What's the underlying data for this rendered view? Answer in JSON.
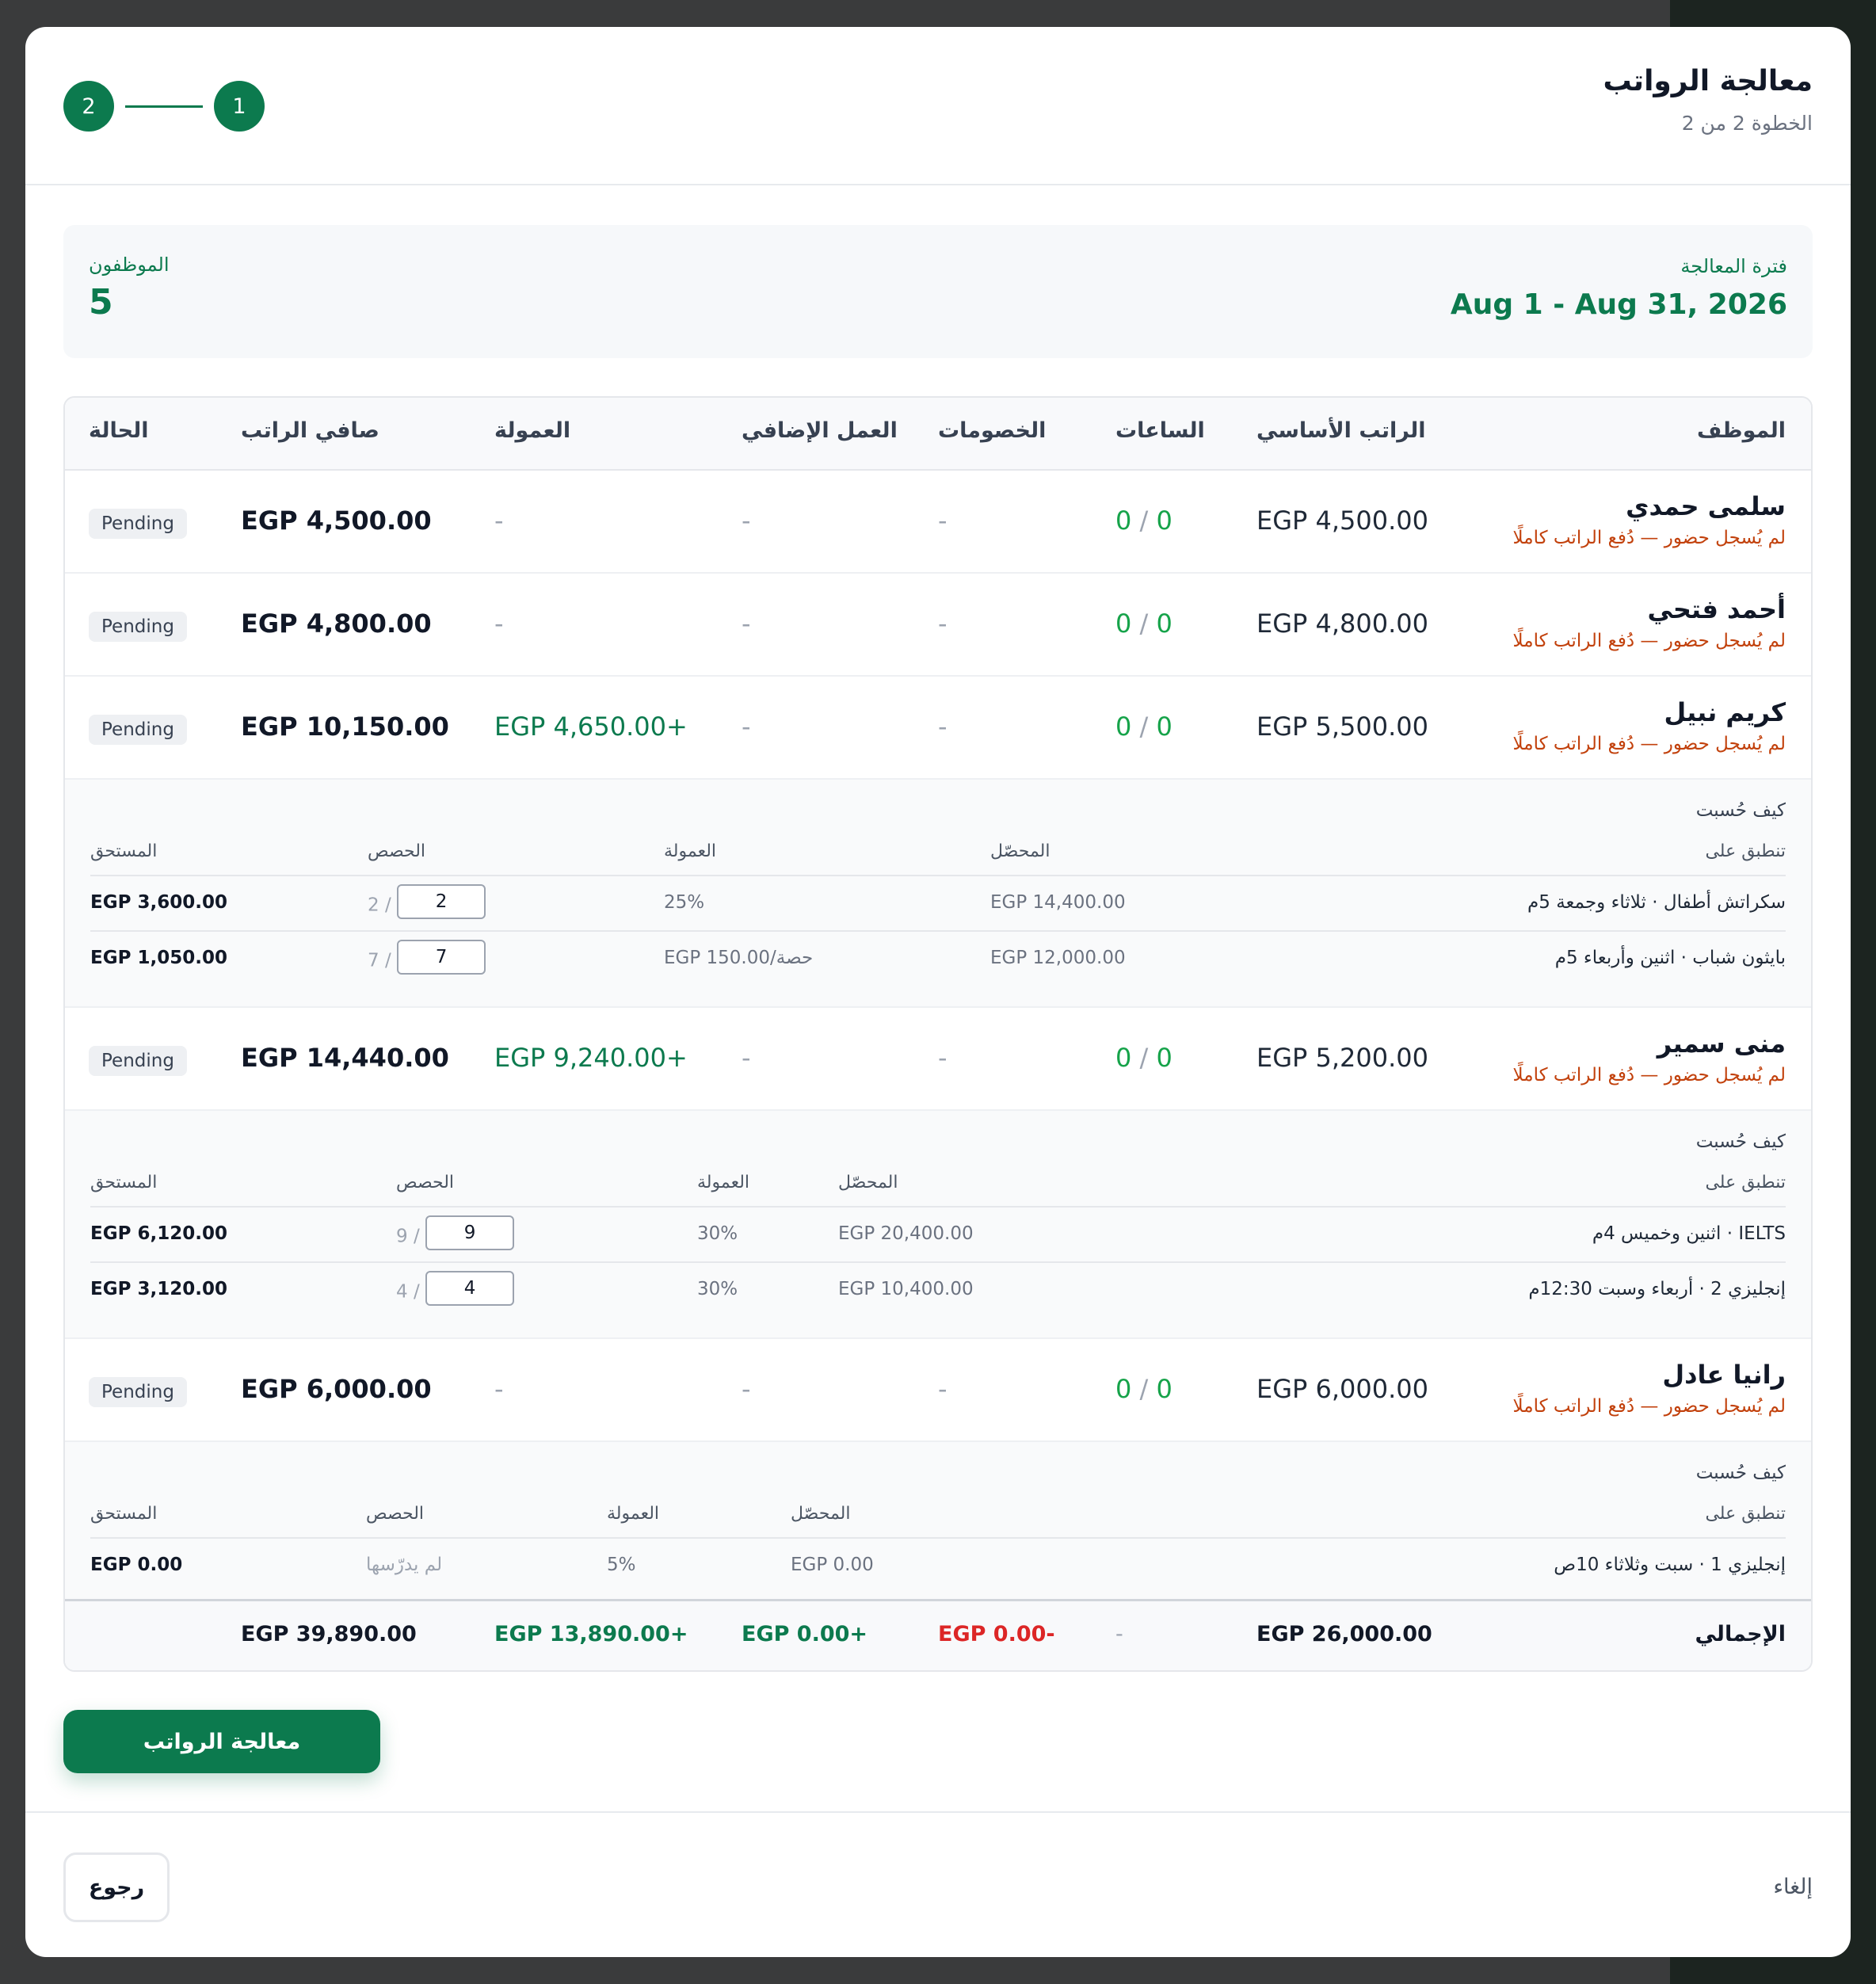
{
  "header": {
    "title": "معالجة الرواتب",
    "subtitle": "الخطوة 2 من 2",
    "steps": [
      "1",
      "2"
    ]
  },
  "summary": {
    "period_label": "فترة المعالجة",
    "period": "Aug 1 - Aug 31, 2026",
    "employees_label": "الموظفون",
    "employees": "5"
  },
  "columns": {
    "employee": "الموظف",
    "base": "الراتب الأساسي",
    "hours": "الساعات",
    "deductions": "الخصومات",
    "overtime": "العمل الإضافي",
    "commission": "العمولة",
    "net": "صافي الراتب",
    "status": "الحالة"
  },
  "employees": [
    {
      "name": "سلمى حمدي",
      "note": "لم يُسجل حضور — دُفع الراتب كاملًا",
      "base": "EGP 4,500.00",
      "hours_a": "0",
      "hours_b": "0",
      "deductions": "-",
      "overtime": "-",
      "commission": "-",
      "net": "EGP 4,500.00",
      "status": "Pending"
    },
    {
      "name": "أحمد فتحي",
      "note": "لم يُسجل حضور — دُفع الراتب كاملًا",
      "base": "EGP 4,800.00",
      "hours_a": "0",
      "hours_b": "0",
      "deductions": "-",
      "overtime": "-",
      "commission": "-",
      "net": "EGP 4,800.00",
      "status": "Pending"
    },
    {
      "name": "كريم نبيل",
      "note": "لم يُسجل حضور — دُفع الراتب كاملًا",
      "base": "EGP 5,500.00",
      "hours_a": "0",
      "hours_b": "0",
      "deductions": "-",
      "overtime": "-",
      "commission": "EGP 4,650.00+",
      "net": "EGP 10,150.00",
      "status": "Pending"
    },
    {
      "name": "منى سمير",
      "note": "لم يُسجل حضور — دُفع الراتب كاملًا",
      "base": "EGP 5,200.00",
      "hours_a": "0",
      "hours_b": "0",
      "deductions": "-",
      "overtime": "-",
      "commission": "EGP 9,240.00+",
      "net": "EGP 14,440.00",
      "status": "Pending"
    },
    {
      "name": "رانيا عادل",
      "note": "لم يُسجل حضور — دُفع الراتب كاملًا",
      "base": "EGP 6,000.00",
      "hours_a": "0",
      "hours_b": "0",
      "deductions": "-",
      "overtime": "-",
      "commission": "-",
      "net": "EGP 6,000.00",
      "status": "Pending"
    }
  ],
  "breakdown_labels": {
    "title": "كيف حُسبت",
    "applies_to": "تنطبق على",
    "collected": "المحصّل",
    "commission": "العمولة",
    "sessions": "الحصص",
    "due": "المستحق",
    "not_taught": "لم يدرّسها"
  },
  "breakdowns": {
    "karim": [
      {
        "course": "سكراتش أطفال · ثلاثاء وجمعة 5م",
        "collected": "EGP 14,400.00",
        "rate": "25%",
        "sessions_value": "2",
        "sessions_total": "2 /",
        "due": "EGP 3,600.00"
      },
      {
        "course": "بايثون شباب · اثنين وأربعاء 5م",
        "collected": "EGP 12,000.00",
        "rate": "EGP 150.00/حصة",
        "sessions_value": "7",
        "sessions_total": "7 /",
        "due": "EGP 1,050.00"
      }
    ],
    "mona": [
      {
        "course": "IELTS · اثنين وخميس 4م",
        "collected": "EGP 20,400.00",
        "rate": "30%",
        "sessions_value": "9",
        "sessions_total": "9 /",
        "due": "EGP 6,120.00"
      },
      {
        "course": "إنجليزي 2 · أربعاء وسبت 12:30م",
        "collected": "EGP 10,400.00",
        "rate": "30%",
        "sessions_value": "4",
        "sessions_total": "4 /",
        "due": "EGP 3,120.00"
      }
    ],
    "rania": [
      {
        "course": "إنجليزي 1 · سبت وثلاثاء 10ص",
        "collected": "EGP 0.00",
        "rate": "5%",
        "due": "EGP 0.00"
      }
    ]
  },
  "totals": {
    "label": "الإجمالي",
    "base": "EGP 26,000.00",
    "hours": "-",
    "deductions": "EGP 0.00-",
    "overtime": "EGP 0.00+",
    "commission": "EGP 13,890.00+",
    "net": "EGP 39,890.00"
  },
  "actions": {
    "process": "معالجة الرواتب",
    "back": "رجوع",
    "cancel": "إلغاء"
  },
  "colors": {
    "accent": "#0c7a4e",
    "warning": "#c2410c",
    "negative": "#dc2626"
  }
}
